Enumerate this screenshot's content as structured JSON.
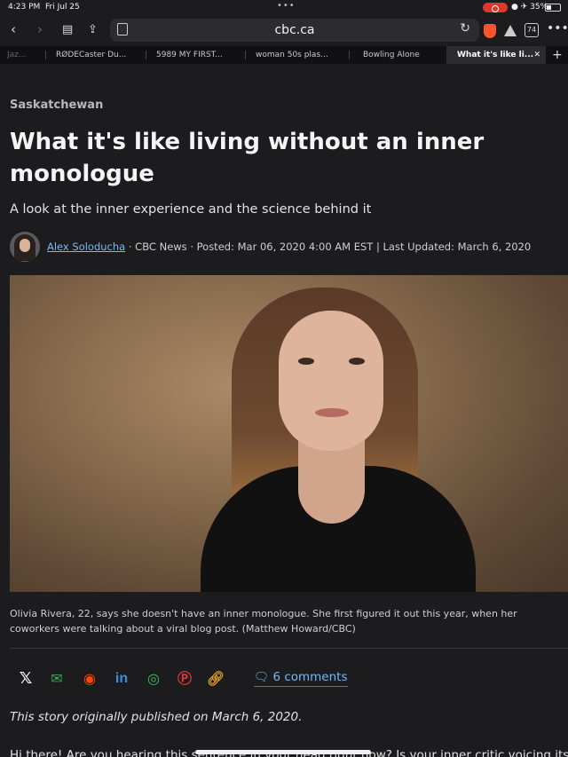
{
  "status_bar": {
    "time": "4:23 PM",
    "date": "Fri Jul 25",
    "battery": "35%"
  },
  "toolbar": {
    "url": "cbc.ca",
    "tab_count": "74"
  },
  "tabs": [
    {
      "label": "Jaz..."
    },
    {
      "label": "RØDECaster Du..."
    },
    {
      "label": "5989 MY FIRST..."
    },
    {
      "label": "woman 50s plas..."
    },
    {
      "label": "Bowling Alone"
    },
    {
      "label": "What it's like li..."
    }
  ],
  "article": {
    "section": "Saskatchewan",
    "headline": "What it's like living without an inner monologue",
    "subhead": "A look at the inner experience and the science behind it",
    "author": "Alex Soloducha",
    "byline_rest": " · CBC News · Posted: Mar 06, 2020 4:00 AM EST | Last Updated: March 6, 2020",
    "caption": "Olivia Rivera, 22, says she doesn't have an inner monologue. She first figured it out this year, when her coworkers were talking about a viral blog post. (Matthew Howard/CBC)",
    "comments": "6 comments",
    "publish_note": "This story originally published on March 6, 2020.",
    "body_start": "Hi there! Are you hearing this sentence in your head right now? Is your inner critic voicing its"
  },
  "share_icons": [
    "x-icon",
    "email-icon",
    "reddit-icon",
    "linkedin-icon",
    "whatsapp-icon",
    "pinterest-icon",
    "link-icon"
  ],
  "colors": {
    "link": "#79b8f5",
    "background": "#1c1c1e",
    "brave": "#fb542b",
    "record": "#e0352b"
  }
}
